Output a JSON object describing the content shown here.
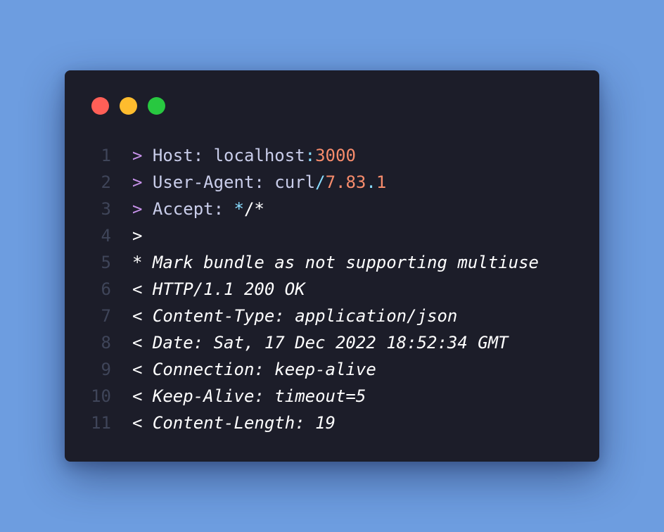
{
  "colors": {
    "background": "#6d9de0",
    "window": "#1c1d29",
    "line_number": "#3f4559",
    "prompt": "#c792ea",
    "key": "#c9cdea",
    "value": "#c9cdea",
    "number": "#f78c6c",
    "operator": "#89ddff",
    "response": "#ffffff",
    "dot_red": "#ff5f57",
    "dot_yellow": "#febc2e",
    "dot_green": "#28c840"
  },
  "window_controls": {
    "close": "close-dot",
    "minimize": "minimize-dot",
    "maximize": "maximize-dot"
  },
  "lines": [
    {
      "num": "1",
      "tokens": [
        {
          "text": "> ",
          "kind": "prompt"
        },
        {
          "text": "Host:",
          "kind": "key"
        },
        {
          "text": " localhost",
          "kind": "value"
        },
        {
          "text": ":",
          "kind": "operator"
        },
        {
          "text": "3000",
          "kind": "number"
        }
      ]
    },
    {
      "num": "2",
      "tokens": [
        {
          "text": "> ",
          "kind": "prompt"
        },
        {
          "text": "User-Agent:",
          "kind": "key"
        },
        {
          "text": " curl",
          "kind": "value"
        },
        {
          "text": "/",
          "kind": "operator"
        },
        {
          "text": "7.83",
          "kind": "number"
        },
        {
          "text": ".",
          "kind": "operator"
        },
        {
          "text": "1",
          "kind": "number"
        }
      ]
    },
    {
      "num": "3",
      "tokens": [
        {
          "text": "> ",
          "kind": "prompt"
        },
        {
          "text": "Accept:",
          "kind": "key"
        },
        {
          "text": " ",
          "kind": "value"
        },
        {
          "text": "*",
          "kind": "operator"
        },
        {
          "text": "/*",
          "kind": "response"
        }
      ]
    },
    {
      "num": "4",
      "tokens": [
        {
          "text": ">",
          "kind": "response"
        }
      ]
    },
    {
      "num": "5",
      "italic": true,
      "tokens": [
        {
          "text": "* Mark bundle as not supporting multiuse",
          "kind": "response"
        }
      ]
    },
    {
      "num": "6",
      "italic": true,
      "tokens": [
        {
          "text": "< HTTP/1.1 200 OK",
          "kind": "response"
        }
      ]
    },
    {
      "num": "7",
      "italic": true,
      "tokens": [
        {
          "text": "< Content-Type: application/json",
          "kind": "response"
        }
      ]
    },
    {
      "num": "8",
      "italic": true,
      "tokens": [
        {
          "text": "< Date: Sat, 17 Dec 2022 18:52:34 GMT",
          "kind": "response"
        }
      ]
    },
    {
      "num": "9",
      "italic": true,
      "tokens": [
        {
          "text": "< Connection: keep-alive",
          "kind": "response"
        }
      ]
    },
    {
      "num": "10",
      "italic": true,
      "tokens": [
        {
          "text": "< Keep-Alive: timeout=5",
          "kind": "response"
        }
      ]
    },
    {
      "num": "11",
      "italic": true,
      "tokens": [
        {
          "text": "< Content-Length: 19",
          "kind": "response"
        }
      ]
    }
  ]
}
